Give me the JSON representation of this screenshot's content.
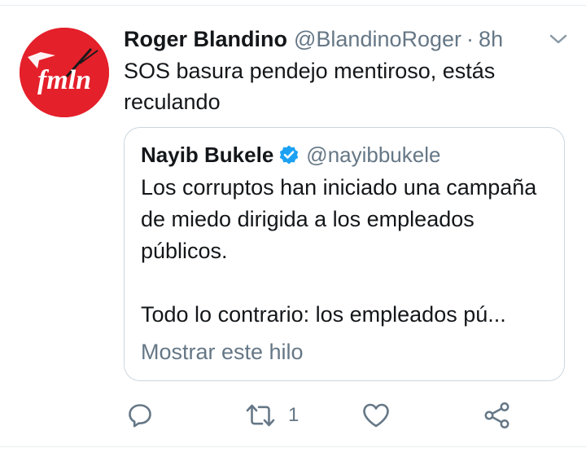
{
  "tweet": {
    "author_name": "Roger Blandino",
    "author_handle": "@BlandinoRoger",
    "separator": "·",
    "time": "8h",
    "text": "SOS basura pendejo mentiroso, estás reculando",
    "avatar_text": "fmln",
    "avatar_color": "#e4202a"
  },
  "quote": {
    "author_name": "Nayib Bukele",
    "author_handle": "@nayibbukele",
    "verified": true,
    "paragraph1": "Los corruptos han iniciado una campaña de miedo dirigida a los empleados públicos.",
    "paragraph2": "Todo lo contrario: los empleados pú...",
    "show_thread": "Mostrar este hilo"
  },
  "actions": {
    "reply_icon": "reply-icon",
    "retweet_icon": "retweet-icon",
    "retweet_count": "1",
    "like_icon": "heart-icon",
    "share_icon": "share-icon"
  },
  "colors": {
    "primary_text": "#14171a",
    "secondary_text": "#657786",
    "border": "#ccd6dd",
    "verified_blue": "#1da1f2"
  }
}
